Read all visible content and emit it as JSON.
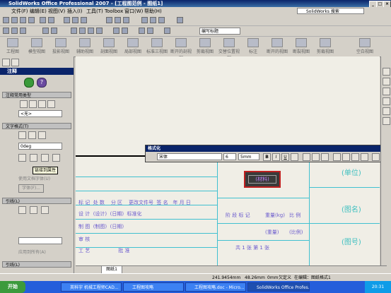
{
  "titlebar": {
    "title": "SolidWorks Office Professional 2007 - [工程图范例 - 图纸1]"
  },
  "menu": {
    "items": [
      "文件(F)",
      "编辑(E)",
      "视图(V)",
      "插入(I)",
      "工具(T)",
      "Toolbox",
      "窗口(W)",
      "帮助(H)"
    ],
    "search_placeholder": "SolidWorks 搜索"
  },
  "toolbar": {
    "layer_combo": "编写标题"
  },
  "bigbar": {
    "buttons": [
      "工程图",
      "模型视图",
      "投影视图",
      "辅助视图",
      "剖面视图",
      "局部视图",
      "标准三视图",
      "断开的剖视图",
      "剪裁视图",
      "交替位置视图",
      "标注",
      "断开的视图",
      "断裂视图",
      "剪裁视图",
      "空白视图"
    ]
  },
  "panel": {
    "title": "注释",
    "groups": {
      "common": "注释常用类型",
      "style": "文字格式(T)",
      "leader": "引线(L)",
      "leader2": "引线(L)"
    },
    "style_select": "<无>",
    "angle_value": "0deg",
    "tooltip": "链接到属性",
    "checkbox1": "使用文档字体(U)",
    "font_button": "字体(F)...",
    "checkbox2": "应用到所有(A)"
  },
  "drawing": {
    "unit_label": "(单位)",
    "drawing_name": "(图名)",
    "drawing_number": "(图号)",
    "material": "(材料)",
    "header_row": [
      "标 记",
      "处 数",
      "分 区",
      "更改文件号",
      "签 名",
      "年 月 日"
    ],
    "rows": [
      {
        "label": "设 计",
        "v1": "(设计)",
        "v2": "(日期)",
        "v3": "标准化"
      },
      {
        "label": "制 图",
        "v1": "(制图)",
        "v2": "(日期)"
      },
      {
        "label": "审 核"
      },
      {
        "label": "工 艺",
        "v3": "批 准"
      }
    ],
    "stage_mark": "阶 段 标 记",
    "weight": "重量(kg)",
    "ratio": "比 例",
    "weight_val": "(重量)",
    "ratio_val": "(比例)",
    "sheets": "共 1   张   第 1   张"
  },
  "format_bar": {
    "title": "格式化",
    "font": "宋体",
    "size": "6",
    "height": "5mm",
    "bold": "B",
    "italic": "I",
    "underline": "U"
  },
  "sheet_tab": "图纸1",
  "status": {
    "x": "241.9454mm",
    "y": "48.26mm",
    "z": "0mm",
    "state": "欠定义",
    "mode": "在编辑：图纸格式1"
  },
  "taskbar": {
    "start": "开始",
    "tasks": [
      "英科宇 机械工程师CAD...",
      "工程图攻略",
      "工程图攻略.doc - Micro...",
      "SolidWorks Office Profes..."
    ],
    "clock": "20:31"
  },
  "colors": {
    "accent": "#0a246a",
    "line": "#40c0d0",
    "text": "#6a5acd",
    "material_border": "#c02020"
  }
}
